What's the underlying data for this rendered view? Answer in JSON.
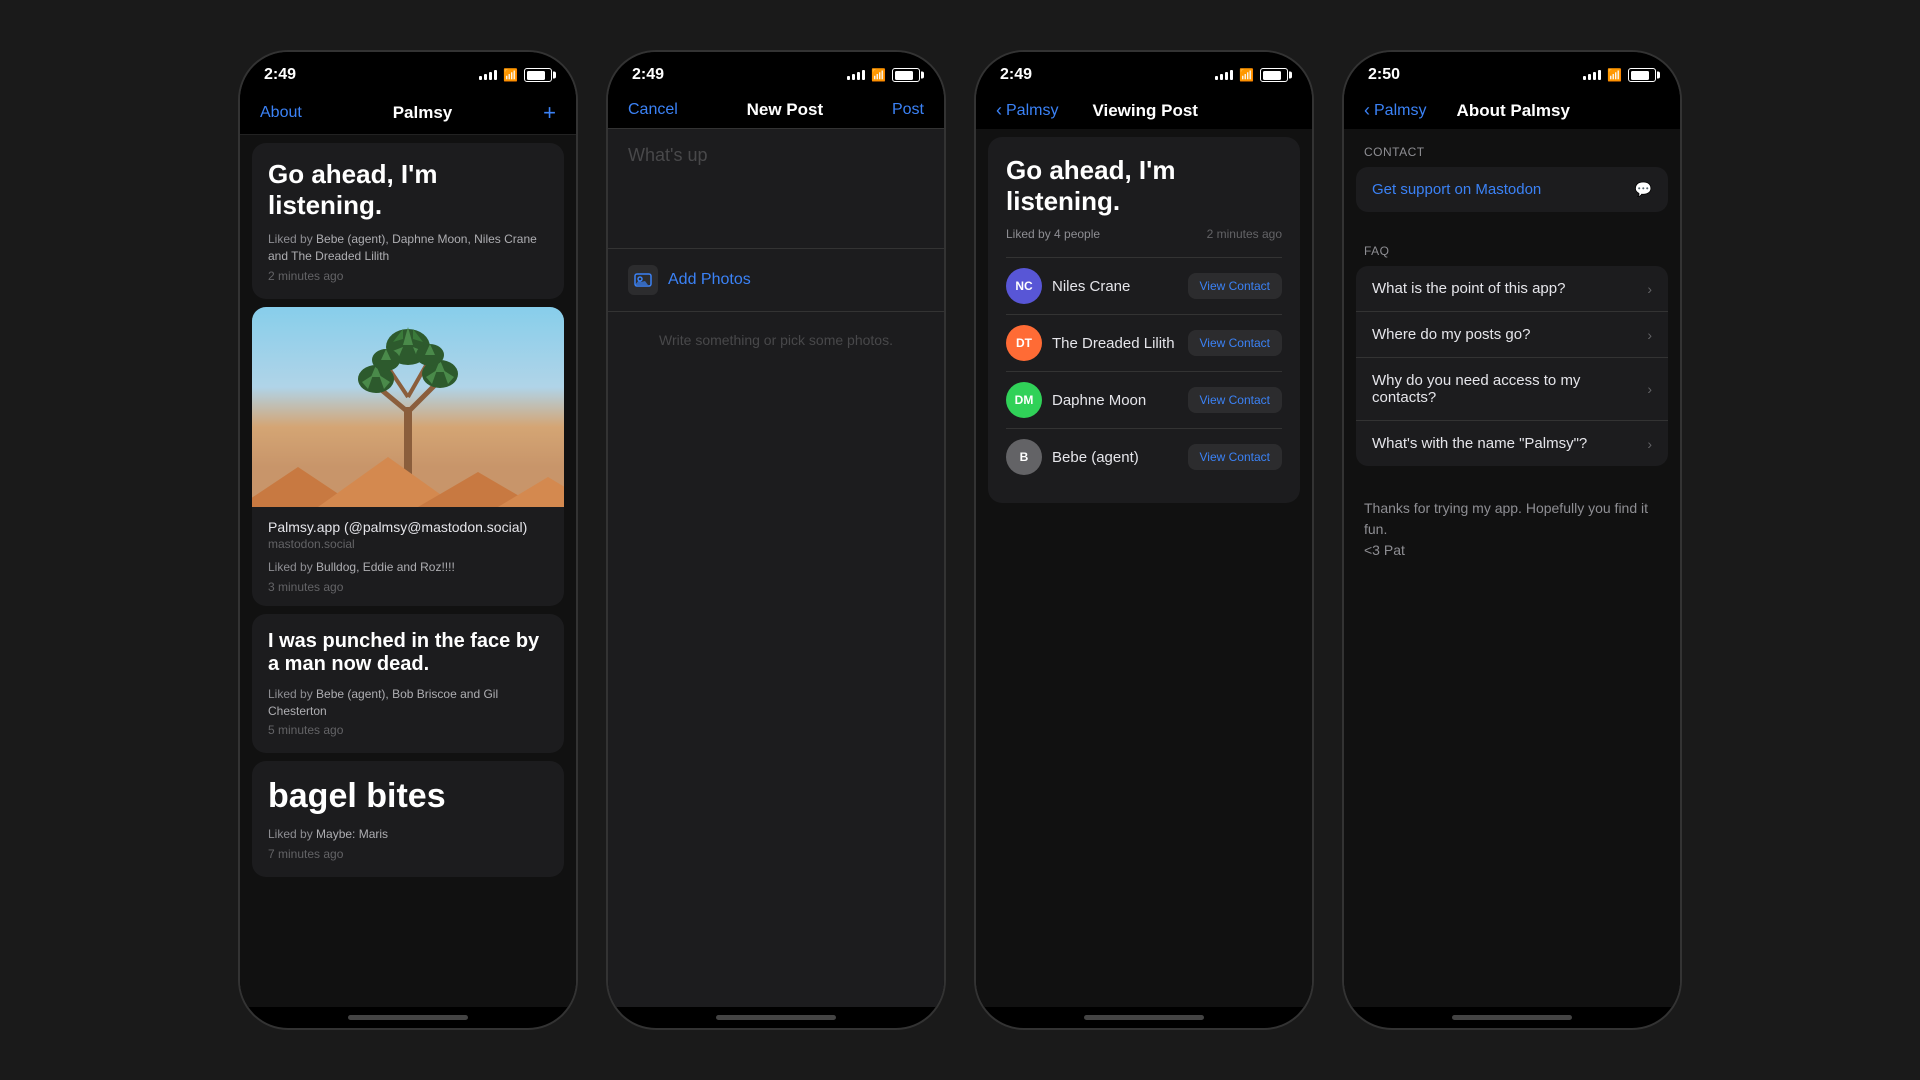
{
  "phones": {
    "phone1": {
      "time": "2:49",
      "nav": {
        "about": "About",
        "title": "Palmsy",
        "plus": "+"
      },
      "posts": [
        {
          "id": "p1",
          "text": "Go ahead, I'm listening.",
          "liked_by": "Liked by ",
          "liked_names": "Bebe (agent), Daphne Moon, Niles Crane and The Dreaded Lilith",
          "time": "2 minutes ago"
        },
        {
          "id": "p2",
          "author": "Palmsy.app (@palmsy@mastodon.social)",
          "domain": "mastodon.social",
          "liked_by": "Liked by ",
          "liked_names": "Bulldog, Eddie and Roz!!!!",
          "time": "3 minutes ago"
        },
        {
          "id": "p3",
          "text": "I was punched in the face by a man now dead.",
          "liked_by": "Liked by ",
          "liked_names": "Bebe (agent), Bob Briscoe and Gil Chesterton",
          "time": "5 minutes ago"
        },
        {
          "id": "p4",
          "text": "bagel bites",
          "liked_by": "Liked by ",
          "liked_names": "Maybe: Maris",
          "time": "7 minutes ago"
        }
      ]
    },
    "phone2": {
      "time": "2:49",
      "nav": {
        "cancel": "Cancel",
        "title": "New Post",
        "post": "Post"
      },
      "placeholder": "What's up",
      "add_photos": "Add Photos",
      "write_hint": "Write something or pick some photos."
    },
    "phone3": {
      "time": "2:49",
      "nav": {
        "back": "Palmsy",
        "title": "Viewing Post"
      },
      "post_text": "Go ahead, I'm listening.",
      "liked_by": "Liked by 4 people",
      "time_ago": "2 minutes ago",
      "contacts": [
        {
          "initials": "NC",
          "name": "Niles Crane",
          "color": "#5856d6",
          "btn": "View Contact"
        },
        {
          "initials": "DT",
          "name": "The Dreaded Lilith",
          "color": "#ff6b35",
          "btn": "View Contact"
        },
        {
          "initials": "DM",
          "name": "Daphne Moon",
          "color": "#30d158",
          "btn": "View Contact"
        },
        {
          "initials": "B",
          "name": "Bebe (agent)",
          "color": "#636366",
          "btn": "View Contact"
        }
      ]
    },
    "phone4": {
      "time": "2:50",
      "nav": {
        "back": "Palmsy",
        "title": "About Palmsy"
      },
      "contact_section": "CONTACT",
      "mastodon_link": "Get support on Mastodon",
      "faq_section": "FAQ",
      "faq_items": [
        "What is the point of this app?",
        "Where do my posts go?",
        "Why do you need access to my contacts?",
        "What's with the name \"Palmsy\"?"
      ],
      "footer": "Thanks for trying my app. Hopefully you find it fun.\n<3 Pat"
    }
  }
}
